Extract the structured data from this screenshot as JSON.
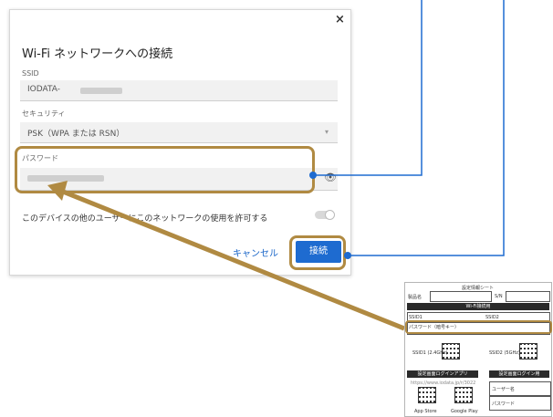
{
  "dialog": {
    "close_label": "×",
    "title": "Wi-Fi ネットワークへの接続",
    "ssid_label": "SSID",
    "ssid_value": "IODATA-",
    "security_label": "セキュリティ",
    "security_value": "PSK（WPA または RSN）",
    "password_label": "パスワード",
    "allow_label": "このデバイスの他のユーザーにこのネットワークの使用を許可する",
    "cancel_label": "キャンセル",
    "connect_label": "接続"
  },
  "card": {
    "title": "設定情報シート",
    "product_label": "製品名",
    "serial_label": "S/N",
    "wifi_header": "Wi-Fi接続用",
    "ssid1_label": "SSID1",
    "ssid2_label": "SSID2",
    "password_label": "パスワード（暗号キー）",
    "ssid1_note": "SSID1 (2.4GHz)",
    "ssid2_note": "SSID2 (5GHz)",
    "app_header": "設定画面ログインアプリ",
    "login_header": "設定画面ログイン用",
    "user_label": "ユーザー名",
    "card_password_label": "パスワード",
    "url": "https://www.iodata.jp/r/3022",
    "app_store": "App Store",
    "google_play": "Google Play"
  },
  "colors": {
    "highlight": "#b08a42",
    "connector": "#1e6bd0",
    "accent": "#1e6bd0"
  }
}
